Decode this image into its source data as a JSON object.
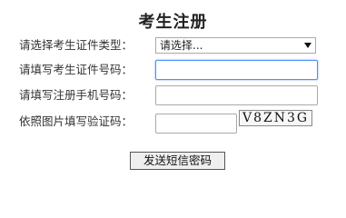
{
  "page": {
    "title": "考生注册"
  },
  "form": {
    "id_type": {
      "label": "请选择考生证件类型：",
      "selected": "请选择..."
    },
    "id_number": {
      "label": "请填写考生证件号码：",
      "value": ""
    },
    "phone": {
      "label": "请填写注册手机号码：",
      "value": ""
    },
    "captcha": {
      "label": "依照图片填写验证码：",
      "value": "",
      "image_text": "V8ZN3G"
    },
    "submit_label": "发送短信密码"
  }
}
